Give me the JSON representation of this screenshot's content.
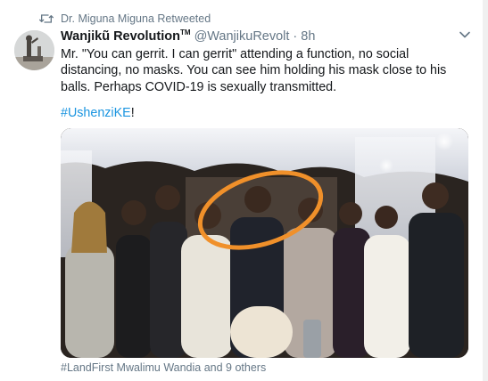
{
  "retweet": {
    "icon": "retweet-icon",
    "label": "Dr. Miguna Miguna Retweeted"
  },
  "tweet": {
    "author_name": "Wanjikũ Revolution",
    "author_suffix": "TM",
    "handle": "@WanjikuRevolt",
    "separator": "·",
    "time": "8h",
    "menu_icon": "chevron-down-icon",
    "text": "Mr. \"You can gerrit. I can gerrit\" attending a function, no social distancing, no masks. You can see him holding his mask close to his balls. Perhaps COVID-19 is sexually transmitted.",
    "hashtag": "#UshenziKE",
    "hashtag_suffix": "!",
    "photo_tags": "#LandFirst Mwalimu Wandia and 9 others"
  },
  "colors": {
    "link": "#1b95e0",
    "secondary_text": "#657786",
    "highlight_circle": "#f0902a"
  }
}
